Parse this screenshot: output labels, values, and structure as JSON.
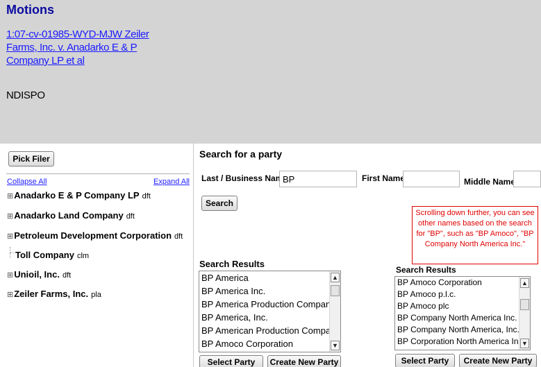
{
  "header": {
    "title": "Motions",
    "case_link": "1:07-cv-01985-WYD-MJW Zeiler Farms, Inc. v. Anadarko E & P Company LP et al",
    "status": "NDISPO"
  },
  "left": {
    "pick_filer": "Pick Filer",
    "collapse_all": "Collapse All",
    "expand_all": "Expand All",
    "tree": [
      {
        "expander": "⊞",
        "name": "Anadarko E & P Company LP",
        "role": "dft"
      },
      {
        "expander": "⊞",
        "name": "Anadarko Land Company",
        "role": "dft"
      },
      {
        "expander": "⊞",
        "name": "Petroleum Development Corporation",
        "role": "dft"
      },
      {
        "expander": "",
        "name": "Toll Company",
        "role": "clm"
      },
      {
        "expander": "⊞",
        "name": "Unioil, Inc.",
        "role": "dft"
      },
      {
        "expander": "⊞",
        "name": "Zeiler Farms, Inc.",
        "role": "pla"
      }
    ]
  },
  "search": {
    "title": "Search for a party",
    "last_label": "Last / Business Name",
    "last_value": "BP",
    "first_label": "First Name",
    "first_value": "",
    "middle_label": "Middle Name",
    "middle_value": "",
    "button": "Search"
  },
  "results": {
    "title": "Search Results",
    "items": [
      "BP America",
      "BP America Inc.",
      "BP America Production Company",
      "BP America, Inc.",
      "BP American Production Company",
      "BP Amoco Corporation"
    ],
    "select_party": "Select Party",
    "create_new_party": "Create New Party"
  },
  "callout": {
    "text": "Scrolling down further, you can see other names based on the search for \"BP\", such as \"BP Amoco\", \"BP Company North America Inc.\""
  },
  "inset": {
    "title": "Search Results",
    "items": [
      "BP Amoco Corporation",
      "BP Amoco p.l.c.",
      "BP Amoco plc",
      "BP Company North America Inc.",
      "BP Company North America, Inc.",
      "BP Corporation North America Inc."
    ],
    "select_party": "Select Party",
    "create_new_party": "Create New Party"
  },
  "icons": {
    "scroll_up": "▲",
    "scroll_down": "▼"
  },
  "colors": {
    "header_bg": "#d4d4d4",
    "title": "#0a0aa0",
    "link": "#1a1aff",
    "callout": "#e00000"
  }
}
